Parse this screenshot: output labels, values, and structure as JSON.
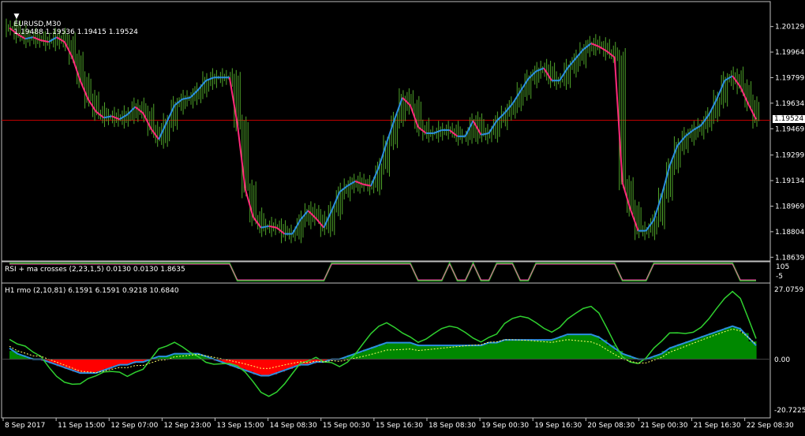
{
  "header": {
    "symbol": "EURUSD,M30",
    "ohlc": "1.19488 1.19536 1.19415 1.19524"
  },
  "current_price": "1.19524",
  "colors": {
    "background": "#000000",
    "frame": "#c0c0c0",
    "bars": "#4fa42a",
    "ma_up": "#2b8fe0",
    "ma_down": "#ff2a7a",
    "price_line": "#c00000",
    "rsi_line": "#22cc22",
    "rsi_line2": "#ff3fb0",
    "rmo_pos": "#008800",
    "rmo_neg": "#ff0000",
    "rmo_fast": "#2fd02f",
    "rmo_mid": "#2b8fe0",
    "rmo_signal": "#ffff66"
  },
  "panes": {
    "rsi": {
      "title": "RSI + ma crosses (2,23,1,5) 0.0130 0.0130 1.8635",
      "top_label": "105",
      "bottom_label": "-5"
    },
    "rmo": {
      "title": "H1 rmo (2,10,81) 6.1591 6.1591 0.9218 10.6840",
      "top_label": "27.0759",
      "zero_label": "0.00",
      "bottom_label": "-20.7225"
    }
  },
  "chart_data": [
    {
      "type": "line",
      "title": "EURUSD,M30",
      "y_ticks": [
        "1.20129",
        "1.19964",
        "1.19799",
        "1.19634",
        "1.19469",
        "1.19299",
        "1.19134",
        "1.18969",
        "1.18804",
        "1.18639"
      ],
      "x_ticks": [
        "8 Sep 2017",
        "11 Sep 15:00",
        "12 Sep 07:00",
        "12 Sep 23:00",
        "13 Sep 15:00",
        "14 Sep 08:30",
        "15 Sep 00:30",
        "15 Sep 16:30",
        "18 Sep 08:30",
        "19 Sep 00:30",
        "19 Sep 16:30",
        "20 Sep 08:30",
        "21 Sep 00:30",
        "21 Sep 16:30",
        "22 Sep 08:30"
      ],
      "ylim": [
        1.1862,
        1.2028
      ],
      "series": [
        {
          "values": [
            1.2012,
            1.2008,
            1.2005,
            1.2006,
            1.2004,
            1.2003,
            1.2006,
            1.2003,
            1.1993,
            1.1978,
            1.1966,
            1.1958,
            1.1954,
            1.1955,
            1.1953,
            1.1956,
            1.1961,
            1.1957,
            1.1947,
            1.194,
            1.1951,
            1.1962,
            1.1966,
            1.1967,
            1.1972,
            1.1978,
            1.198,
            1.198,
            1.198,
            1.195,
            1.1908,
            1.189,
            1.1883,
            1.1884,
            1.1883,
            1.1879,
            1.1879,
            1.1888,
            1.1894,
            1.1889,
            1.1883,
            1.1894,
            1.1906,
            1.191,
            1.1913,
            1.1911,
            1.191,
            1.1922,
            1.1938,
            1.1953,
            1.1967,
            1.1962,
            1.1948,
            1.1944,
            1.1944,
            1.1946,
            1.1946,
            1.1942,
            1.1942,
            1.1952,
            1.1943,
            1.1944,
            1.1952,
            1.1957,
            1.1963,
            1.1971,
            1.1979,
            1.1984,
            1.1986,
            1.1978,
            1.1978,
            1.1986,
            1.1992,
            1.1998,
            1.2002,
            1.2,
            1.1997,
            1.1993,
            1.1912,
            1.1895,
            1.1881,
            1.1881,
            1.1888,
            1.1904,
            1.1923,
            1.1936,
            1.1942,
            1.1946,
            1.1949,
            1.1956,
            1.1966,
            1.1978,
            1.1981,
            1.1974,
            1.1963,
            1.1953
          ]
        }
      ]
    },
    {
      "type": "line",
      "title": "RSI + ma crosses (2,23,1,5) 0.0130 0.0130 1.8635",
      "ylim": [
        -5,
        105
      ],
      "y_ticks": [
        "105",
        "-5"
      ],
      "series": [
        {
          "values": [
            100,
            100,
            100,
            100,
            100,
            100,
            100,
            100,
            100,
            100,
            100,
            100,
            100,
            100,
            100,
            100,
            100,
            100,
            100,
            100,
            100,
            100,
            100,
            100,
            100,
            100,
            100,
            100,
            100,
            0,
            0,
            0,
            0,
            0,
            0,
            0,
            0,
            0,
            0,
            0,
            0,
            100,
            100,
            100,
            100,
            100,
            100,
            100,
            100,
            100,
            100,
            100,
            0,
            0,
            0,
            0,
            100,
            0,
            0,
            100,
            0,
            0,
            100,
            100,
            100,
            0,
            0,
            100,
            100,
            100,
            100,
            100,
            100,
            100,
            100,
            100,
            100,
            100,
            0,
            0,
            0,
            0,
            100,
            100,
            100,
            100,
            100,
            100,
            100,
            100,
            100,
            100,
            100,
            0,
            0,
            0
          ]
        }
      ]
    },
    {
      "type": "area",
      "title": "H1 rmo (2,10,81) 6.1591 6.1591 0.9218 10.6840",
      "ylim": [
        -20.7225,
        27.0759
      ],
      "y_ticks": [
        "27.0759",
        "0.00",
        "-20.7225"
      ],
      "series": [
        {
          "name": "H1 rmo",
          "values": [
            4,
            2,
            1,
            0,
            0,
            -1,
            -2,
            -3,
            -4,
            -5,
            -5,
            -5,
            -4,
            -3,
            -2,
            -2,
            -1,
            -1,
            0,
            1,
            1,
            2,
            2,
            2,
            2,
            1,
            0,
            -1,
            -2,
            -3,
            -4,
            -5,
            -6,
            -6,
            -5,
            -4,
            -3,
            -2,
            -2,
            -1,
            -1,
            0,
            0,
            1,
            2,
            3,
            4,
            5,
            6,
            6,
            6,
            6,
            5,
            5,
            5,
            5,
            5,
            5,
            5,
            5,
            5,
            6,
            6,
            7,
            7,
            7,
            7,
            7,
            7,
            7,
            8,
            9,
            9,
            9,
            9,
            8,
            6,
            4,
            2,
            1,
            0,
            0,
            1,
            2,
            4,
            5,
            6,
            7,
            8,
            9,
            10,
            11,
            12,
            11,
            8,
            5
          ]
        }
      ]
    }
  ]
}
